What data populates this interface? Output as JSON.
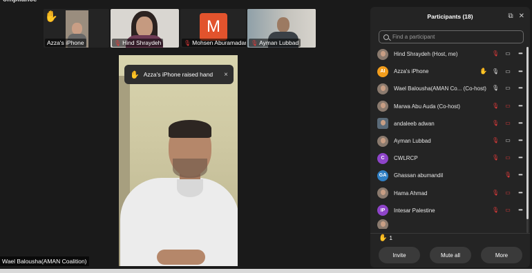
{
  "window": {
    "title_fragment": "ompliance"
  },
  "video_strip": [
    {
      "name": "Azza's iPhone",
      "hand_raised": true,
      "muted": false
    },
    {
      "name": "Hind Shraydeh",
      "muted": true
    },
    {
      "name": "Mohsen Aburamadan",
      "muted": true,
      "avatar_letter": "M",
      "avatar_color": "#e2532d"
    },
    {
      "name": "Ayman Lubbad",
      "muted": true
    }
  ],
  "main_video": {
    "speaker_name": "Wael Baloushа(AMAN Coalition)"
  },
  "toast": {
    "text": "Azza's iPhone raised hand",
    "close": "×"
  },
  "panel": {
    "title": "Participants (18)",
    "search_placeholder": "Find a participant",
    "participants": [
      {
        "name": "Hind Shraydeh (Host, me)",
        "avatar": "photo",
        "icons": [
          "mic-muted",
          "video-on"
        ]
      },
      {
        "name": "Azza's iPhone",
        "avatar": "AI",
        "avatar_color": "#f29d1c",
        "icons": [
          "hand",
          "mic-on",
          "video-on"
        ]
      },
      {
        "name": "Wael Baloushа(AMAN Co...  (Co-host)",
        "avatar": "photo",
        "icons": [
          "mic-speaking",
          "video-on"
        ]
      },
      {
        "name": "Marwa Abu Auda (Co-host)",
        "avatar": "photo",
        "icons": [
          "mic-muted",
          "video-off"
        ]
      },
      {
        "name": "andaleeb adwan",
        "avatar": "photo",
        "icons": [
          "mic-muted",
          "video-off"
        ]
      },
      {
        "name": "Ayman Lubbad",
        "avatar": "photo",
        "icons": [
          "mic-muted",
          "video-on"
        ]
      },
      {
        "name": "CWLRCP",
        "avatar": "C",
        "avatar_color": "#8e44c9",
        "icons": [
          "mic-muted",
          "video-off"
        ]
      },
      {
        "name": "Ghassan abumandil",
        "avatar": "GA",
        "avatar_color": "#2f7fc4",
        "icons": [
          "mic-muted"
        ]
      },
      {
        "name": "Hama Ahmad",
        "avatar": "photo",
        "icons": [
          "mic-muted",
          "video-off"
        ]
      },
      {
        "name": "Intesar Palestine",
        "avatar": "IP",
        "avatar_color": "#8e44c9",
        "icons": [
          "mic-muted",
          "video-off"
        ]
      },
      {
        "name": "",
        "avatar": "photo",
        "icons": [
          "mic-muted",
          "video-off"
        ]
      }
    ],
    "raised_count": "1",
    "buttons": {
      "invite": "Invite",
      "mute_all": "Mute all",
      "more": "More"
    }
  },
  "colors": {
    "muted_red": "#e23a3a",
    "hand_yellow": "#f5c518",
    "panel_bg": "#242424"
  }
}
